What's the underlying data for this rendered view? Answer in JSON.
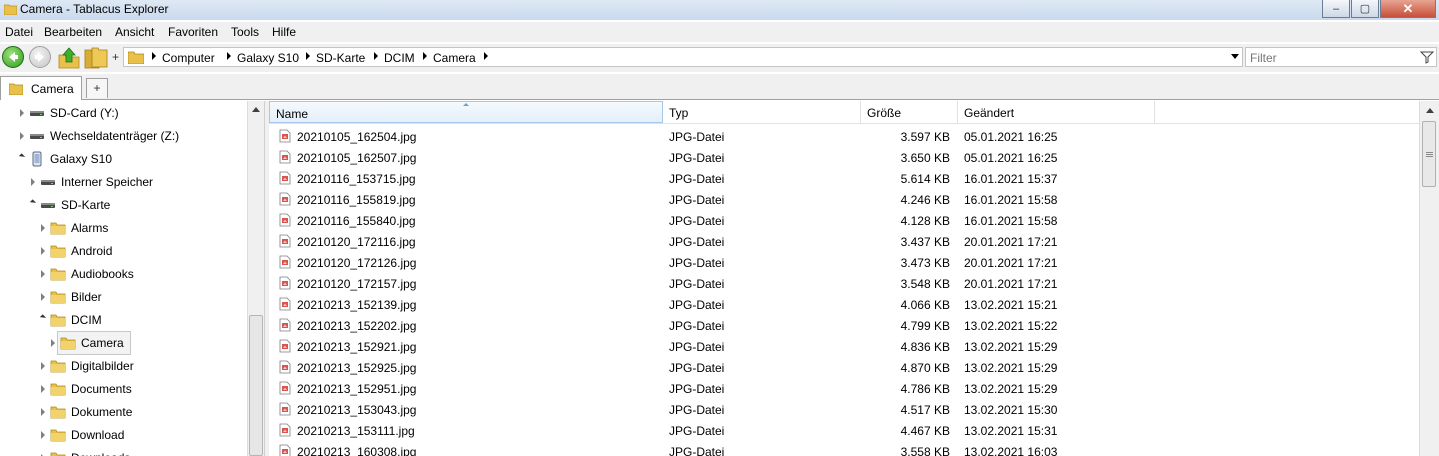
{
  "window": {
    "title": "Camera - Tablacus Explorer",
    "controls": {
      "minimize": "‒",
      "maximize": "▢",
      "close": "✕"
    }
  },
  "menu": [
    "Datei",
    "Bearbeiten",
    "Ansicht",
    "Favoriten",
    "Tools",
    "Hilfe"
  ],
  "toolbar": {
    "plus": "+"
  },
  "address": {
    "crumbs": [
      "Computer",
      "Galaxy S10",
      "SD-Karte",
      "DCIM",
      "Camera"
    ]
  },
  "filter": {
    "placeholder": "Filter"
  },
  "tabs": {
    "active": "Camera",
    "add": "+"
  },
  "tree": {
    "items": [
      {
        "label": "SD-Card (Y:)",
        "icon": "drive-icon",
        "level": 0,
        "toggle": "collapsed"
      },
      {
        "label": "Wechseldatenträger (Z:)",
        "icon": "drive-icon",
        "level": 0,
        "toggle": "collapsed"
      },
      {
        "label": "Galaxy S10",
        "icon": "phone-icon",
        "level": 0,
        "toggle": "expanded"
      },
      {
        "label": "Interner Speicher",
        "icon": "drive-icon",
        "level": 1,
        "toggle": "collapsed"
      },
      {
        "label": "SD-Karte",
        "icon": "drive-icon",
        "level": 1,
        "toggle": "expanded"
      },
      {
        "label": "Alarms",
        "icon": "folder-icon",
        "level": 2,
        "toggle": "collapsed"
      },
      {
        "label": "Android",
        "icon": "folder-icon",
        "level": 2,
        "toggle": "collapsed"
      },
      {
        "label": "Audiobooks",
        "icon": "folder-icon",
        "level": 2,
        "toggle": "collapsed"
      },
      {
        "label": "Bilder",
        "icon": "folder-icon",
        "level": 2,
        "toggle": "collapsed"
      },
      {
        "label": "DCIM",
        "icon": "folder-icon",
        "level": 2,
        "toggle": "expanded"
      },
      {
        "label": "Camera",
        "icon": "folder-icon",
        "level": 3,
        "toggle": "collapsed",
        "selected": true
      },
      {
        "label": "Digitalbilder",
        "icon": "folder-icon",
        "level": 2,
        "toggle": "collapsed"
      },
      {
        "label": "Documents",
        "icon": "folder-icon",
        "level": 2,
        "toggle": "collapsed"
      },
      {
        "label": "Dokumente",
        "icon": "folder-icon",
        "level": 2,
        "toggle": "collapsed"
      },
      {
        "label": "Download",
        "icon": "folder-icon",
        "level": 2,
        "toggle": "collapsed"
      },
      {
        "label": "Downloads",
        "icon": "folder-icon",
        "level": 2,
        "toggle": "collapsed"
      }
    ]
  },
  "list": {
    "columns": {
      "name": "Name",
      "type": "Typ",
      "size": "Größe",
      "modified": "Geändert"
    },
    "rows": [
      {
        "name": "20210105_162504.jpg",
        "type": "JPG-Datei",
        "size": "3.597 KB",
        "modified": "05.01.2021 16:25"
      },
      {
        "name": "20210105_162507.jpg",
        "type": "JPG-Datei",
        "size": "3.650 KB",
        "modified": "05.01.2021 16:25"
      },
      {
        "name": "20210116_153715.jpg",
        "type": "JPG-Datei",
        "size": "5.614 KB",
        "modified": "16.01.2021 15:37"
      },
      {
        "name": "20210116_155819.jpg",
        "type": "JPG-Datei",
        "size": "4.246 KB",
        "modified": "16.01.2021 15:58"
      },
      {
        "name": "20210116_155840.jpg",
        "type": "JPG-Datei",
        "size": "4.128 KB",
        "modified": "16.01.2021 15:58"
      },
      {
        "name": "20210120_172116.jpg",
        "type": "JPG-Datei",
        "size": "3.437 KB",
        "modified": "20.01.2021 17:21"
      },
      {
        "name": "20210120_172126.jpg",
        "type": "JPG-Datei",
        "size": "3.473 KB",
        "modified": "20.01.2021 17:21"
      },
      {
        "name": "20210120_172157.jpg",
        "type": "JPG-Datei",
        "size": "3.548 KB",
        "modified": "20.01.2021 17:21"
      },
      {
        "name": "20210213_152139.jpg",
        "type": "JPG-Datei",
        "size": "4.066 KB",
        "modified": "13.02.2021 15:21"
      },
      {
        "name": "20210213_152202.jpg",
        "type": "JPG-Datei",
        "size": "4.799 KB",
        "modified": "13.02.2021 15:22"
      },
      {
        "name": "20210213_152921.jpg",
        "type": "JPG-Datei",
        "size": "4.836 KB",
        "modified": "13.02.2021 15:29"
      },
      {
        "name": "20210213_152925.jpg",
        "type": "JPG-Datei",
        "size": "4.870 KB",
        "modified": "13.02.2021 15:29"
      },
      {
        "name": "20210213_152951.jpg",
        "type": "JPG-Datei",
        "size": "4.786 KB",
        "modified": "13.02.2021 15:29"
      },
      {
        "name": "20210213_153043.jpg",
        "type": "JPG-Datei",
        "size": "4.517 KB",
        "modified": "13.02.2021 15:30"
      },
      {
        "name": "20210213_153111.jpg",
        "type": "JPG-Datei",
        "size": "4.467 KB",
        "modified": "13.02.2021 15:31"
      },
      {
        "name": "20210213_160308.jpg",
        "type": "JPG-Datei",
        "size": "3.558 KB",
        "modified": "13.02.2021 16:03"
      }
    ]
  }
}
